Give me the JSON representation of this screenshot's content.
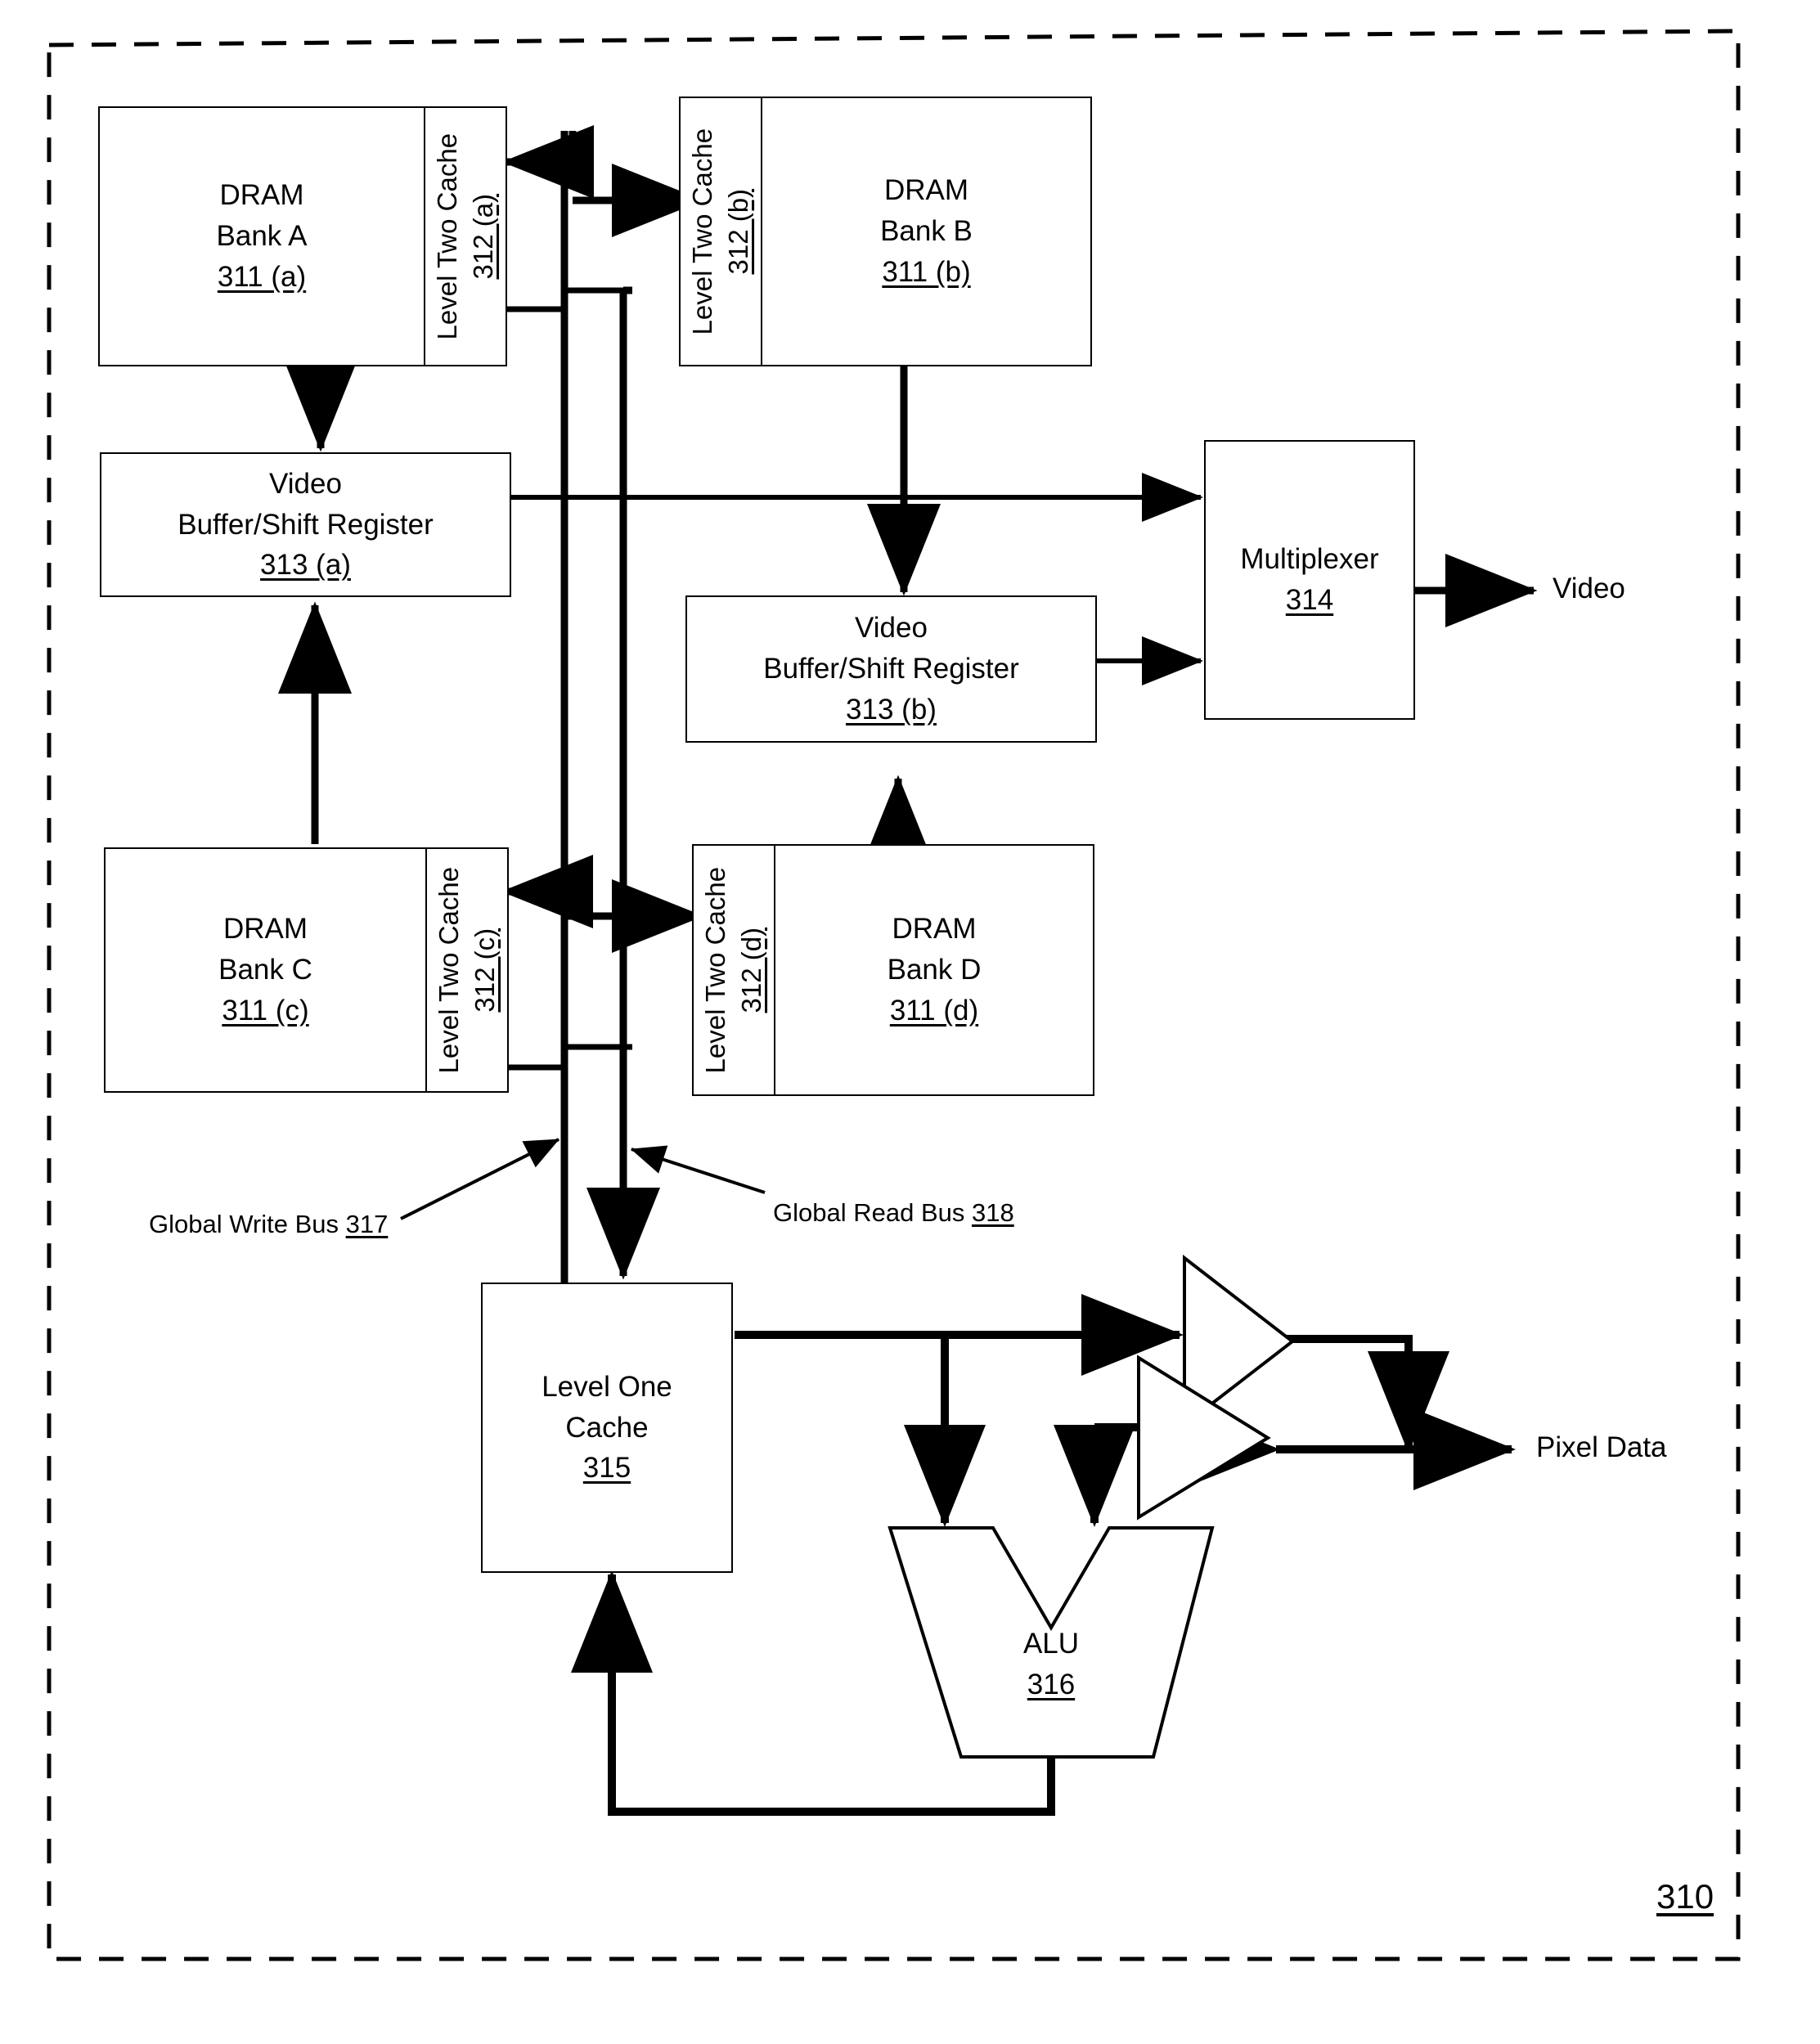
{
  "figure": {
    "number": "310",
    "border_style": "dashed",
    "stroke_color": "#000000",
    "background": "#ffffff"
  },
  "blocks": {
    "dram_a": {
      "line1": "DRAM",
      "line2": "Bank A",
      "ref": "311 (a)"
    },
    "dram_b": {
      "line1": "DRAM",
      "line2": "Bank B",
      "ref": "311 (b)"
    },
    "dram_c": {
      "line1": "DRAM",
      "line2": "Bank C",
      "ref": "311 (c)"
    },
    "dram_d": {
      "line1": "DRAM",
      "line2": "Bank D",
      "ref": "311 (d)"
    },
    "l2_a": {
      "label": "Level Two Cache",
      "ref": "312 (a)"
    },
    "l2_b": {
      "label": "Level Two Cache",
      "ref": "312 (b)"
    },
    "l2_c": {
      "label": "Level Two Cache",
      "ref": "312 (c)"
    },
    "l2_d": {
      "label": "Level Two Cache",
      "ref": "312 (d)"
    },
    "vbuf_a": {
      "line1": "Video",
      "line2": "Buffer/Shift Register",
      "ref": "313 (a)"
    },
    "vbuf_b": {
      "line1": "Video",
      "line2": "Buffer/Shift Register",
      "ref": "313 (b)"
    },
    "mux": {
      "label": "Multiplexer",
      "ref": "314"
    },
    "l1": {
      "line1": "Level One",
      "line2": "Cache",
      "ref": "315"
    },
    "alu": {
      "label": "ALU",
      "ref": "316"
    }
  },
  "bus_labels": {
    "write_bus": {
      "text": "Global Write Bus ",
      "ref": "317"
    },
    "read_bus": {
      "text": "Global Read Bus ",
      "ref": "318"
    }
  },
  "io_labels": {
    "video": "Video",
    "pixel_data": "Pixel Data"
  }
}
